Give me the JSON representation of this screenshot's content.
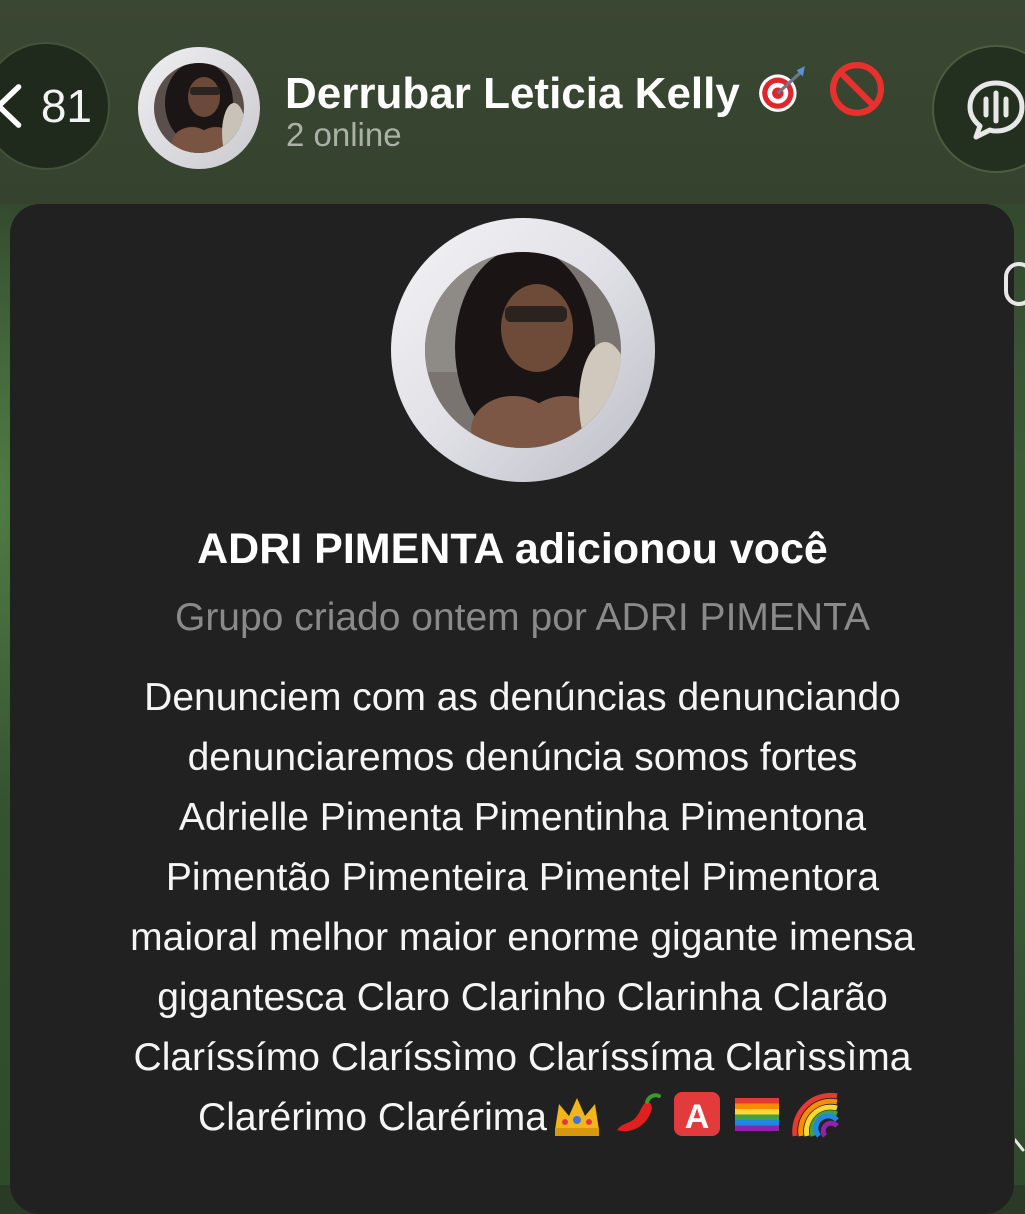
{
  "header": {
    "back_count": "81",
    "title": "Derrubar Leticia Kelly",
    "title_emojis": [
      "direct-hit-emoji",
      "no-entry-emoji"
    ],
    "subtitle": "2 online"
  },
  "message": {
    "added_text": "ADRI PIMENTA adicionou você",
    "created_text": "Grupo criado ontem por ADRI PIMENTA",
    "description_lines": [
      "Denunciem com as denúncias denunciando",
      "denunciaremos denúncia somos fortes",
      "Adrielle Pimenta Pimentinha Pimentona",
      "Pimentão Pimenteira Pimentel Pimentora",
      "maioral melhor maior enorme gigante imensa",
      "gigantesca Claro Clarinho Clarinha Clarão",
      "Claríssímo Claríssìmo Claríssíma Clarìssìma",
      "Clarérimo Clarérima"
    ],
    "trailing_emojis": [
      "crown-emoji",
      "hot-pepper-emoji",
      "a-button-emoji",
      "rainbow-flag-emoji",
      "rainbow-emoji"
    ]
  },
  "colors": {
    "header_bg": "#36432f",
    "bubble_bg": "#202120",
    "title_text": "#ffffff",
    "secondary_text": "#8a8a8a",
    "online_text": "#a9b2a4"
  }
}
